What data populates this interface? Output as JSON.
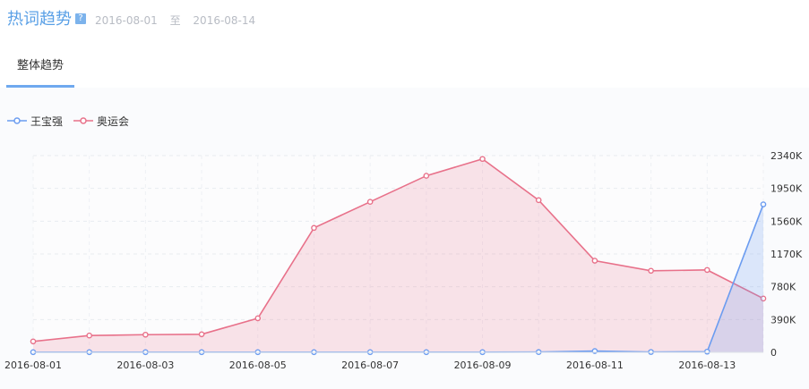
{
  "header": {
    "title": "热词趋势",
    "help_icon": "?",
    "start_date": "2016-08-01",
    "separator": "至",
    "end_date": "2016-08-14"
  },
  "tabs": [
    {
      "label": "整体趋势",
      "active": true
    }
  ],
  "colors": {
    "accent": "#5aa0e6",
    "series_wang": "#6b9cf0",
    "series_ao": "#e8718a"
  },
  "chart_data": {
    "type": "area",
    "x": [
      "2016-08-01",
      "2016-08-02",
      "2016-08-03",
      "2016-08-04",
      "2016-08-05",
      "2016-08-06",
      "2016-08-07",
      "2016-08-08",
      "2016-08-09",
      "2016-08-10",
      "2016-08-11",
      "2016-08-12",
      "2016-08-13",
      "2016-08-14"
    ],
    "x_tick_labels": [
      "2016-08-01",
      "2016-08-03",
      "2016-08-05",
      "2016-08-07",
      "2016-08-09",
      "2016-08-11",
      "2016-08-13"
    ],
    "y_tick_labels": [
      "0",
      "390K",
      "780K",
      "1170K",
      "1560K",
      "1950K",
      "2340K"
    ],
    "ylim": [
      0,
      2340000
    ],
    "y_axis_position": "right",
    "legend_position": "top-left",
    "grid": true,
    "series": [
      {
        "name": "王宝强",
        "color": "#6b9cf0",
        "fill": "rgba(107,156,240,0.22)",
        "values": [
          2000,
          2000,
          2000,
          2000,
          2000,
          2000,
          2000,
          2000,
          2000,
          3000,
          15000,
          4000,
          8000,
          1760000
        ]
      },
      {
        "name": "奥运会",
        "color": "#e8718a",
        "fill": "rgba(232,113,138,0.18)",
        "values": [
          130000,
          200000,
          210000,
          215000,
          405000,
          1480000,
          1790000,
          2100000,
          2300000,
          1810000,
          1090000,
          970000,
          980000,
          640000
        ]
      }
    ]
  }
}
